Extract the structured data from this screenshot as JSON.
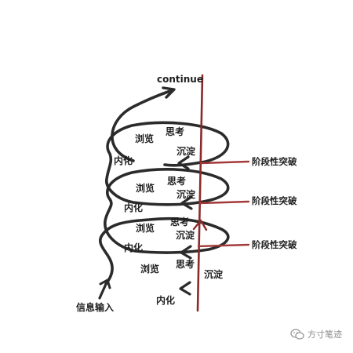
{
  "labels": {
    "continue": "continue",
    "input": "信息输入",
    "browse": "浏览",
    "think": "思考",
    "settle": "沉淀",
    "internalize": "内化",
    "breakthrough": "阶段性突破"
  },
  "watermark": {
    "text": "方寸笔迹"
  },
  "colors": {
    "spiral": "#2b2b2b",
    "axis": "#8b2a2a",
    "branch": "#a33a3a",
    "watermark": "#9a9a9a"
  }
}
